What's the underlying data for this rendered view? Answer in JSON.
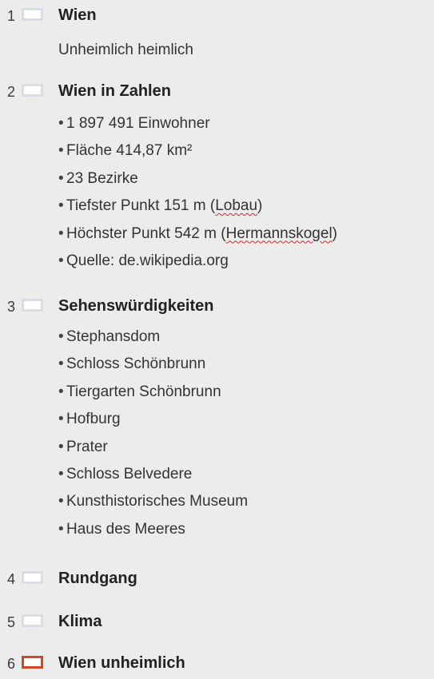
{
  "slides": [
    {
      "number": "1",
      "title": "Wien",
      "subtitle": "Unheimlich heimlich",
      "selected": false
    },
    {
      "number": "2",
      "title": "Wien in Zahlen",
      "bullets": [
        "1 897 491 Einwohner",
        "Fläche 414,87 km²",
        "23 Bezirke",
        {
          "before": "Tiefster Punkt 151 m (",
          "flagged": "Lobau",
          "after": ")"
        },
        {
          "before": "Höchster Punkt 542 m (",
          "flagged": "Hermannskogel",
          "after": ")"
        },
        "Quelle: de.wikipedia.org"
      ],
      "selected": false
    },
    {
      "number": "3",
      "title": "Sehenswürdigkeiten",
      "bullets": [
        "Stephansdom",
        "Schloss Schönbrunn",
        "Tiergarten Schönbrunn",
        "Hofburg",
        "Prater",
        "Schloss Belvedere",
        "Kunsthistorisches Museum",
        "Haus des Meeres"
      ],
      "selected": false
    },
    {
      "number": "4",
      "title": "Rundgang",
      "selected": false
    },
    {
      "number": "5",
      "title": "Klima",
      "selected": false
    },
    {
      "number": "6",
      "title": "Wien unheimlich",
      "selected": true
    }
  ],
  "bullet_glyph": "•",
  "colors": {
    "background": "#ececec",
    "selected_thumbnail_border": "#d24726",
    "thumbnail_border": "#d8dde6",
    "spellcheck_underline": "#d62828"
  }
}
